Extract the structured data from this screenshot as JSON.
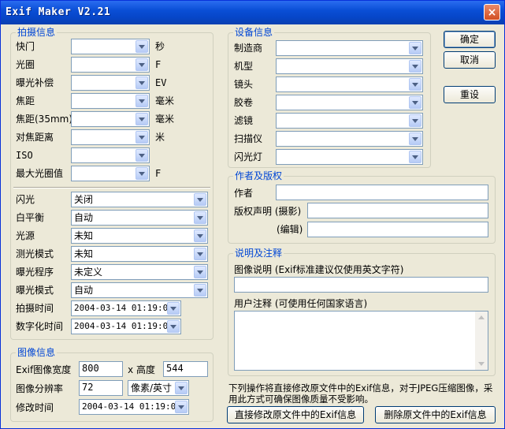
{
  "window": {
    "title": "Exif Maker V2.21",
    "close": "×"
  },
  "shooting": {
    "title": "拍摄信息",
    "shutter": {
      "label": "快门",
      "unit": "秒",
      "value": ""
    },
    "aperture": {
      "label": "光圈",
      "unit": "F",
      "value": ""
    },
    "ev": {
      "label": "曝光补偿",
      "unit": "EV",
      "value": ""
    },
    "focal": {
      "label": "焦距",
      "unit": "毫米",
      "value": ""
    },
    "focal35": {
      "label": "焦距(35mm)",
      "unit": "毫米",
      "value": ""
    },
    "focus_dist": {
      "label": "对焦距离",
      "unit": "米",
      "value": ""
    },
    "iso": {
      "label": "ISO",
      "value": ""
    },
    "max_aperture": {
      "label": "最大光圈值",
      "unit": "F",
      "value": ""
    },
    "flash": {
      "label": "闪光",
      "value": "关闭"
    },
    "wb": {
      "label": "白平衡",
      "value": "自动"
    },
    "light": {
      "label": "光源",
      "value": "未知"
    },
    "metering": {
      "label": "测光模式",
      "value": "未知"
    },
    "program": {
      "label": "曝光程序",
      "value": "未定义"
    },
    "exposure_mode": {
      "label": "曝光模式",
      "value": "自动"
    },
    "shot_time": {
      "label": "拍摄时间",
      "value": "2004-03-14 01:19:06"
    },
    "digitize_time": {
      "label": "数字化时间",
      "value": "2004-03-14 01:19:06"
    }
  },
  "image": {
    "title": "图像信息",
    "size_label": "Exif图像宽度",
    "width": "800",
    "x": "x",
    "height_label": "高度",
    "height": "544",
    "res_label": "图像分辨率",
    "res": "72",
    "res_unit": "像素/英寸",
    "mod_label": "修改时间",
    "mod_time": "2004-03-14 01:19:06"
  },
  "device": {
    "title": "设备信息",
    "make": {
      "label": "制造商",
      "value": ""
    },
    "model": {
      "label": "机型",
      "value": ""
    },
    "lens": {
      "label": "镜头",
      "value": ""
    },
    "film": {
      "label": "胶卷",
      "value": ""
    },
    "filter": {
      "label": "滤镜",
      "value": ""
    },
    "scanner": {
      "label": "扫描仪",
      "value": ""
    },
    "flash_unit": {
      "label": "闪光灯",
      "value": ""
    }
  },
  "author": {
    "title": "作者及版权",
    "author_label": "作者",
    "author": "",
    "copyright_label": "版权声明 (摄影)",
    "copyright_photo": "",
    "edit_label": "(编辑)",
    "copyright_edit": ""
  },
  "notes": {
    "title": "说明及注释",
    "desc_label": "图像说明 (Exif标准建议仅使用英文字符)",
    "desc": "",
    "comment_label": "用户注释 (可使用任何国家语言)",
    "comment": ""
  },
  "buttons": {
    "ok": "确定",
    "cancel": "取消",
    "reset": "重设",
    "modify": "直接修改原文件中的Exif信息",
    "delete": "删除原文件中的Exif信息"
  },
  "footer": {
    "note1": "下列操作将直接修改原文件中的Exif信息，对于JPEG压缩图像，采",
    "note2": "用此方式可确保图像质量不受影响。"
  }
}
